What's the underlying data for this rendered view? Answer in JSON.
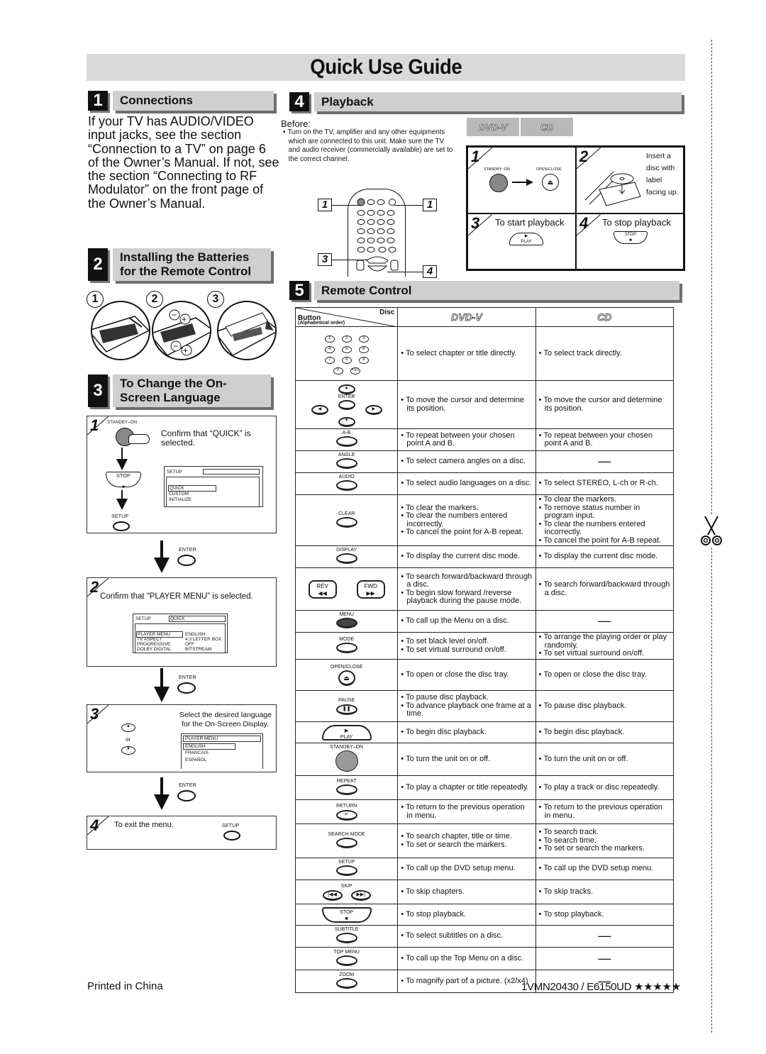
{
  "title": "Quick Use Guide",
  "sections": {
    "connections": {
      "number": "1",
      "title": "Connections",
      "body": "If your TV has AUDIO/VIDEO input jacks, see the section “Connection to a TV” on page 6 of the Owner’s Manual. If not, see the section “Connecting to RF Modulator” on the front page of the Owner’s Manual."
    },
    "batteries": {
      "number": "2",
      "title_line1": "Installing the Batteries",
      "title_line2": "for the Remote Control",
      "steps": [
        "1",
        "2",
        "3"
      ]
    },
    "language": {
      "number": "3",
      "title_line1": "To Change the On-",
      "title_line2": "Screen Language",
      "steps": [
        {
          "num": "1",
          "text": "Confirm that “QUICK” is selected.",
          "labels": {
            "standby": "STANDBY–ON",
            "stop": "STOP",
            "setup": "SETUP"
          },
          "screen": {
            "header": "SETUP",
            "items": [
              "QUICK",
              "CUSTOM",
              "INITIALIZE"
            ]
          }
        },
        {
          "num": "2",
          "text": "Confirm that “PLAYER MENU” is selected.",
          "screen": {
            "header": "SETUP",
            "header_value": "QUICK",
            "rows": [
              {
                "k": "PLAYER MENU",
                "v": "ENGLISH"
              },
              {
                "k": "TV ASPECT",
                "v": "4:3 LETTER BOX"
              },
              {
                "k": "PROGRESSIVE",
                "v": "OFF"
              },
              {
                "k": "DOLBY DIGITAL",
                "v": "BITSTREAM"
              }
            ]
          }
        },
        {
          "num": "3",
          "text_line1": "Select the desired language",
          "text_line2": "for the On-Screen Display.",
          "or": "or",
          "screen": {
            "header": "PLAYER MENU",
            "items": [
              "ENGLISH",
              "FRANCAIS",
              "ESPAÑOL"
            ]
          }
        },
        {
          "num": "4",
          "text": "To exit the menu.",
          "button": "SETUP"
        }
      ],
      "enter_label": "ENTER"
    },
    "playback": {
      "number": "4",
      "title": "Playback",
      "before_label": "Before:",
      "before_text": "Turn on the TV, amplifier and any other equipments which are connected to this unit. Make sure the TV and audio receiver (commercially available) are set to the correct channel.",
      "disc_badges": [
        "DVD-V",
        "CD"
      ],
      "callouts": [
        "1",
        "1",
        "3",
        "4"
      ],
      "steps": {
        "s1": {
          "num": "1",
          "standby": "STANDBY–ON",
          "openclose": "OPEN/CLOSE"
        },
        "s2": {
          "num": "2",
          "text": [
            "Insert a",
            "disc with",
            "label",
            "facing up."
          ]
        },
        "s3": {
          "num": "3",
          "text": "To start playback",
          "button": "PLAY"
        },
        "s4": {
          "num": "4",
          "text": "To stop playback",
          "button": "STOP"
        }
      }
    },
    "remote": {
      "number": "5",
      "title": "Remote Control",
      "header": {
        "button": "Button",
        "order": "(Alphabetical order)",
        "disc": "Disc",
        "dvd": "DVD-V",
        "cd": "CD"
      },
      "rows": [
        {
          "name": "number-keys",
          "keys": [
            "1",
            "2",
            "3",
            "4",
            "5",
            "6",
            "7",
            "8",
            "9",
            "0",
            "+10"
          ],
          "dvd": [
            "To select chapter or title directly."
          ],
          "cd": [
            "To select track directly."
          ]
        },
        {
          "name": "cursor-enter",
          "label": "ENTER",
          "dvd": [
            "To move the cursor and determine its position."
          ],
          "cd": [
            "To move the cursor and determine its position."
          ]
        },
        {
          "name": "a-b",
          "label": "A-B",
          "dvd": [
            "To repeat between your chosen point A and B."
          ],
          "cd": [
            "To repeat between your chosen point A and B."
          ]
        },
        {
          "name": "angle",
          "label": "ANGLE",
          "dvd": [
            "To select camera angles on a disc."
          ],
          "cd": []
        },
        {
          "name": "audio",
          "label": "AUDIO",
          "dvd": [
            "To select audio languages on a disc."
          ],
          "cd": [
            "To select STEREO, L-ch or R-ch."
          ]
        },
        {
          "name": "clear",
          "label": "CLEAR",
          "dvd": [
            "To clear the markers.",
            "To clear the numbers entered incorrectly.",
            "To cancel the point for A-B repeat."
          ],
          "cd": [
            "To clear the markers.",
            "To remove status number in program input.",
            "To clear the numbers entered incorrectly.",
            "To cancel the point for A-B repeat."
          ]
        },
        {
          "name": "display",
          "label": "DISPLAY",
          "dvd": [
            "To display the current disc mode."
          ],
          "cd": [
            "To display the current disc mode."
          ]
        },
        {
          "name": "rev-fwd",
          "label_rev": "REV",
          "label_fwd": "FWD",
          "dvd": [
            "To search forward/backward through a disc.",
            "To begin slow forward /reverse playback during the pause mode."
          ],
          "cd": [
            "To search forward/backward through a disc."
          ]
        },
        {
          "name": "menu",
          "label": "MENU",
          "dvd": [
            "To call up the Menu on a disc."
          ],
          "cd": []
        },
        {
          "name": "mode",
          "label": "MODE",
          "dvd": [
            "To set black level on/off.",
            "To set virtual surround on/off."
          ],
          "cd": [
            "To arrange the playing order or play randomly.",
            "To set virtual surround on/off."
          ]
        },
        {
          "name": "open-close",
          "label": "OPEN/CLOSE",
          "dvd": [
            "To open or close the disc tray."
          ],
          "cd": [
            "To open or close the disc tray."
          ]
        },
        {
          "name": "pause",
          "label": "PAUSE",
          "dvd": [
            "To pause disc playback.",
            "To advance playback one frame at a time."
          ],
          "cd": [
            "To pause disc playback."
          ]
        },
        {
          "name": "play",
          "label": "PLAY",
          "dvd": [
            "To begin disc playback."
          ],
          "cd": [
            "To begin disc playback."
          ]
        },
        {
          "name": "standby-on",
          "label": "STANDBY–ON",
          "dvd": [
            "To turn the unit on or off."
          ],
          "cd": [
            "To turn the unit on or off."
          ]
        },
        {
          "name": "repeat",
          "label": "REPEAT",
          "dvd": [
            "To play a chapter or title repeatedly."
          ],
          "cd": [
            "To play a track or disc repeatedly."
          ]
        },
        {
          "name": "return",
          "label": "RETURN",
          "dvd": [
            "To return to the previous operation in menu."
          ],
          "cd": [
            "To return to the previous operation in menu."
          ]
        },
        {
          "name": "search-mode",
          "label": "SEARCH MODE",
          "dvd": [
            "To search chapter, title or time.",
            "To set or search the markers."
          ],
          "cd": [
            "To search track.",
            "To search time.",
            "To set or search the markers."
          ]
        },
        {
          "name": "setup",
          "label": "SETUP",
          "dvd": [
            "To call up the DVD setup menu."
          ],
          "cd": [
            "To call up the DVD setup menu."
          ]
        },
        {
          "name": "skip",
          "label": "SKIP",
          "dvd": [
            "To skip chapters."
          ],
          "cd": [
            "To skip tracks."
          ]
        },
        {
          "name": "stop",
          "label": "STOP",
          "dvd": [
            "To stop playback."
          ],
          "cd": [
            "To stop playback."
          ]
        },
        {
          "name": "subtitle",
          "label": "SUBTITLE",
          "dvd": [
            "To select subtitles on a disc."
          ],
          "cd": []
        },
        {
          "name": "top-menu",
          "label": "TOP MENU",
          "dvd": [
            "To call up the Top Menu on a disc."
          ],
          "cd": []
        },
        {
          "name": "zoom",
          "label": "ZOOM",
          "dvd": [
            "To magnify part of a picture. (x2/x4)"
          ],
          "cd": []
        }
      ],
      "dash": "—"
    }
  },
  "footer": {
    "printed": "Printed in China",
    "code": "1VMN20430 / E6150UD ★★★★★"
  }
}
